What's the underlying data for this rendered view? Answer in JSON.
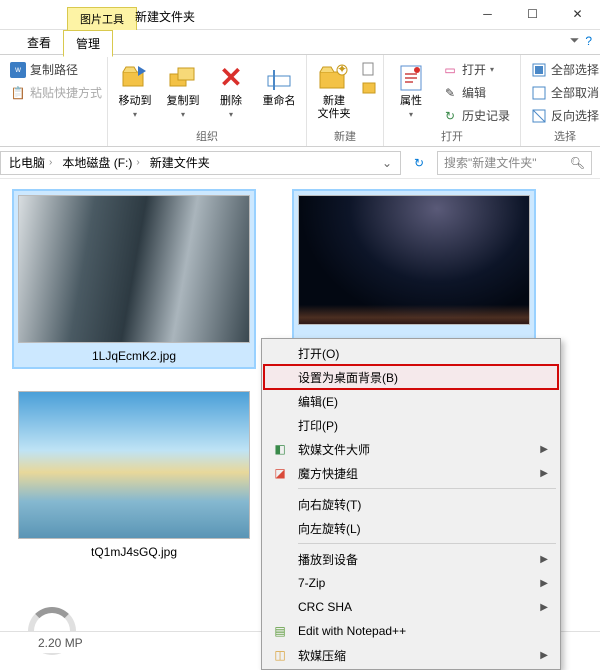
{
  "window": {
    "title": "新建文件夹",
    "contextual_tab": "图片工具"
  },
  "ribbon_tabs": {
    "view": "查看",
    "manage": "管理"
  },
  "ribbon": {
    "clipboard": {
      "copy_path": "复制路径",
      "paste_shortcut": "粘贴快捷方式"
    },
    "organize": {
      "label": "组织",
      "move_to": "移动到",
      "copy_to": "复制到",
      "delete": "删除",
      "rename": "重命名"
    },
    "new": {
      "label": "新建",
      "new_folder": "新建\n文件夹"
    },
    "open": {
      "label": "打开",
      "properties": "属性",
      "open_btn": "打开",
      "edit": "编辑",
      "history": "历史记录"
    },
    "select": {
      "label": "选择",
      "select_all": "全部选择",
      "select_none": "全部取消",
      "invert": "反向选择"
    }
  },
  "breadcrumbs": {
    "pc": "比电脑",
    "drive": "本地磁盘 (F:)",
    "folder": "新建文件夹"
  },
  "search": {
    "placeholder": "搜索\"新建文件夹\""
  },
  "files": [
    {
      "name": "1LJqEcmK2.jpg"
    },
    {
      "name": ""
    },
    {
      "name": "tQ1mJ4sGQ.jpg"
    }
  ],
  "context_menu": {
    "open": "打开(O)",
    "set_wallpaper": "设置为桌面背景(B)",
    "edit": "编辑(E)",
    "print": "打印(P)",
    "ruanmei_master": "软媒文件大师",
    "mofang": "魔方快捷组",
    "rotate_right": "向右旋转(T)",
    "rotate_left": "向左旋转(L)",
    "cast": "播放到设备",
    "sevenzip": "7-Zip",
    "crc": "CRC SHA",
    "notepadpp": "Edit with Notepad++",
    "ruanmei_zip": "软媒压缩"
  },
  "status": {
    "size": "2.20 MP"
  },
  "colors": {
    "accent": "#0078d7",
    "highlight_border": "#d20808"
  }
}
